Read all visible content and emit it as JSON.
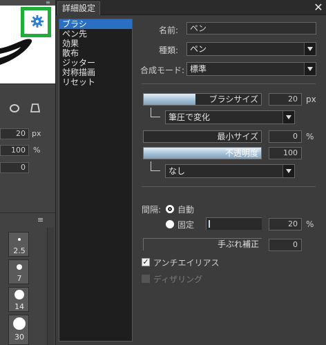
{
  "left_panel": {
    "mini_menu": "≡",
    "fields": [
      {
        "value": "20",
        "unit": "px"
      },
      {
        "value": "100",
        "unit": "%"
      },
      {
        "value": "0",
        "unit": ""
      }
    ],
    "list_menu": "≡",
    "brush_sizes": [
      "2.5",
      "7",
      "14",
      "30"
    ]
  },
  "dialog": {
    "title": "詳細設定",
    "close_symbol": "✕",
    "categories": [
      {
        "label": "ブラシ",
        "selected": true
      },
      {
        "label": "ペン先",
        "selected": false
      },
      {
        "label": "効果",
        "selected": false
      },
      {
        "label": "散布",
        "selected": false
      },
      {
        "label": "ジッター",
        "selected": false
      },
      {
        "label": "対称描画",
        "selected": false
      },
      {
        "label": "リセット",
        "selected": false
      }
    ],
    "name_label": "名前:",
    "name_value": "ペン",
    "type_label": "種類:",
    "type_value": "ペン",
    "blend_label": "合成モード:",
    "blend_value": "標準",
    "brush_size": {
      "label": "ブラシサイズ",
      "value": "20",
      "unit": "px",
      "fill_fraction": 0.44
    },
    "pressure_value": "筆圧で変化",
    "min_size": {
      "label": "最小サイズ",
      "value": "0",
      "unit": "%",
      "fill_fraction": 0.0
    },
    "opacity": {
      "label": "不透明度",
      "value": "100",
      "fill_fraction": 1.0
    },
    "opacity_source_value": "なし",
    "interval_label": "間隔:",
    "interval_auto": "自動",
    "interval_fixed": "固定",
    "interval_value": "20",
    "interval_unit": "%",
    "stabilizer": {
      "label": "手ぶれ補正",
      "value": "0"
    },
    "antialias_label": "アンチエイリアス",
    "antialias_checked": true,
    "dither_label": "ディザリング",
    "dither_checked": false
  },
  "colors": {
    "highlight_frame": "#1fae3a",
    "gear": "#2b7fd4",
    "selection": "#2a6fc4"
  }
}
